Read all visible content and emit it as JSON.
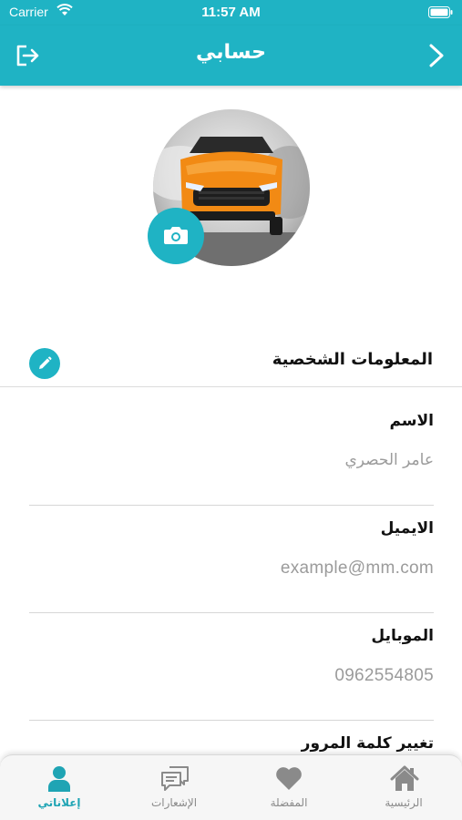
{
  "status_bar": {
    "carrier": "Carrier",
    "time": "11:57 AM"
  },
  "nav": {
    "title": "حسابي"
  },
  "profile": {
    "photo_description": "orange car"
  },
  "personal_info": {
    "title": "المعلومات الشخصية",
    "fields": [
      {
        "label": "الاسم",
        "value": "عامر الحصري"
      },
      {
        "label": "الايميل",
        "value": "example@mm.com"
      },
      {
        "label": "الموبايل",
        "value": "0962554805"
      },
      {
        "label": "تغيير كلمة المرور",
        "value": ""
      }
    ]
  },
  "tab_bar": {
    "items": [
      {
        "label": "إعلاناتي",
        "icon": "person-icon",
        "active": true
      },
      {
        "label": "الإشعارات",
        "icon": "messages-icon",
        "active": false
      },
      {
        "label": "المفضلة",
        "icon": "heart-icon",
        "active": false
      },
      {
        "label": "الرئيسية",
        "icon": "home-icon",
        "active": false
      }
    ]
  },
  "colors": {
    "primary": "#1fb3c4",
    "active_tab": "#1fa4b4",
    "inactive_tab": "#8a8a8a",
    "placeholder_text": "#9b9b9b"
  }
}
